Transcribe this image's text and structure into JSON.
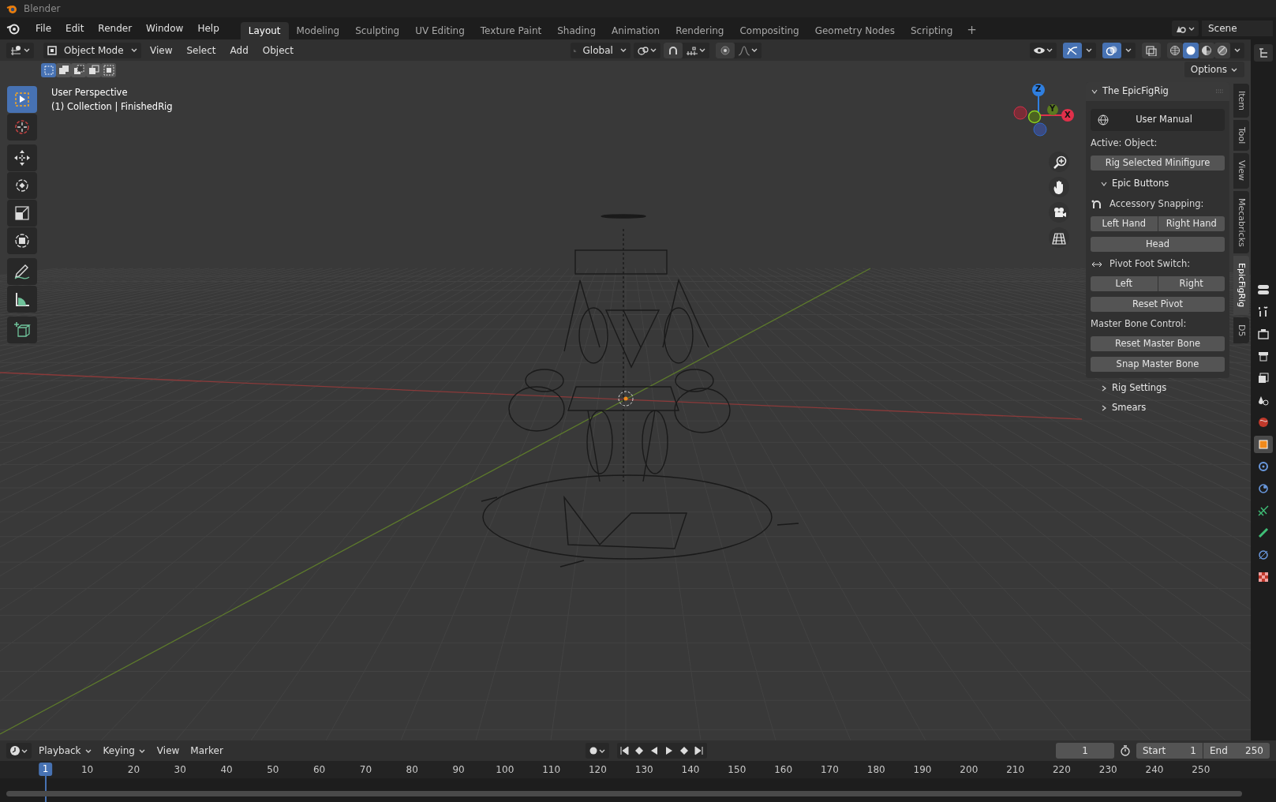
{
  "title_bar": {
    "title": "Blender"
  },
  "menu": [
    "File",
    "Edit",
    "Render",
    "Window",
    "Help"
  ],
  "workspaces": [
    {
      "label": "Layout",
      "selected": true
    },
    {
      "label": "Modeling",
      "selected": false
    },
    {
      "label": "Sculpting",
      "selected": false
    },
    {
      "label": "UV Editing",
      "selected": false
    },
    {
      "label": "Texture Paint",
      "selected": false
    },
    {
      "label": "Shading",
      "selected": false
    },
    {
      "label": "Animation",
      "selected": false
    },
    {
      "label": "Rendering",
      "selected": false
    },
    {
      "label": "Compositing",
      "selected": false
    },
    {
      "label": "Geometry Nodes",
      "selected": false
    },
    {
      "label": "Scripting",
      "selected": false
    }
  ],
  "add_workspace": "+",
  "scene": "Scene",
  "viewport_header": {
    "mode": "Object Mode",
    "menus": [
      "View",
      "Select",
      "Add",
      "Object"
    ],
    "orientation": "Global",
    "options": "Options"
  },
  "viewport_toggles": [
    {
      "kind": "gizmos",
      "on": true
    },
    {
      "kind": "overlays",
      "on": true
    },
    {
      "kind": "xray",
      "on": false
    }
  ],
  "shading": [
    {
      "kind": "wireframe",
      "selected": false
    },
    {
      "kind": "solid",
      "selected": true
    },
    {
      "kind": "material",
      "selected": false
    },
    {
      "kind": "rendered",
      "selected": false
    }
  ],
  "select_modes": [
    {
      "kind": "set",
      "selected": true
    },
    {
      "kind": "extend",
      "selected": false
    },
    {
      "kind": "subtract",
      "selected": false
    },
    {
      "kind": "difference",
      "selected": false
    },
    {
      "kind": "intersect",
      "selected": false
    }
  ],
  "viewport_info": [
    "User Perspective",
    "(1) Collection | FinishedRig"
  ],
  "tools": [
    {
      "kind": "select_box",
      "selected": true
    },
    {
      "kind": "cursor",
      "selected": false
    },
    {
      "kind": "move",
      "selected": false
    },
    {
      "kind": "rotate",
      "selected": false
    },
    {
      "kind": "scale",
      "selected": false
    },
    {
      "kind": "transform",
      "selected": false
    },
    {
      "kind": "annotate",
      "selected": false
    },
    {
      "kind": "measure",
      "selected": false
    },
    {
      "kind": "add_cube",
      "selected": false
    }
  ],
  "gizmo": {
    "z": "Z",
    "y": "Y",
    "x": "X"
  },
  "sidebar": {
    "tabs": [
      {
        "label": "Item",
        "selected": false
      },
      {
        "label": "Tool",
        "selected": false
      },
      {
        "label": "View",
        "selected": false
      },
      {
        "label": "Mecabricks",
        "selected": false
      },
      {
        "label": "EpicFigRig",
        "selected": true
      },
      {
        "label": "D5",
        "selected": false
      }
    ],
    "panel": {
      "title": "The EpicFigRig",
      "expanded": true,
      "items": [
        {
          "kind": "link_button",
          "label": "User Manual"
        },
        {
          "kind": "label",
          "text": "Active: Object:"
        },
        {
          "kind": "buttons",
          "labels": [
            "Rig Selected Minifigure"
          ]
        },
        {
          "kind": "subpanel",
          "title": "Epic Buttons",
          "expanded": true
        },
        {
          "kind": "snap_label",
          "text": "Accessory Snapping:"
        },
        {
          "kind": "buttons",
          "labels": [
            "Left Hand",
            "Right Hand"
          ]
        },
        {
          "kind": "buttons",
          "labels": [
            "Head"
          ]
        },
        {
          "kind": "swap_label",
          "text": "Pivot Foot Switch:"
        },
        {
          "kind": "buttons",
          "labels": [
            "Left",
            "Right"
          ]
        },
        {
          "kind": "buttons",
          "labels": [
            "Reset Pivot"
          ]
        },
        {
          "kind": "label",
          "text": "Master Bone Control:"
        },
        {
          "kind": "buttons",
          "labels": [
            "Reset Master Bone"
          ]
        },
        {
          "kind": "buttons",
          "labels": [
            "Snap Master Bone"
          ]
        }
      ]
    },
    "collapsed_panels": [
      {
        "title": "Rig Settings",
        "expanded": false
      },
      {
        "title": "Smears",
        "expanded": false
      }
    ]
  },
  "properties_tabs": [
    {
      "selected": false
    },
    {
      "selected": false
    },
    {
      "selected": false
    },
    {
      "selected": false
    },
    {
      "selected": false
    },
    {
      "selected": false
    },
    {
      "selected": false
    },
    {
      "selected": true
    },
    {
      "selected": false
    },
    {
      "selected": false
    },
    {
      "selected": false
    },
    {
      "selected": false
    },
    {
      "selected": false
    },
    {
      "selected": false
    }
  ],
  "timeline": {
    "menus": [
      "Playback",
      "Keying",
      "View",
      "Marker"
    ],
    "current_frame": "1",
    "start_label": "Start",
    "start": "1",
    "end_label": "End",
    "end": "250",
    "playhead": "1",
    "ticks": [
      "10",
      "20",
      "30",
      "40",
      "50",
      "60",
      "70",
      "80",
      "90",
      "100",
      "110",
      "120",
      "130",
      "140",
      "150",
      "160",
      "170",
      "180",
      "190",
      "200",
      "210",
      "220",
      "230",
      "240",
      "250"
    ]
  }
}
